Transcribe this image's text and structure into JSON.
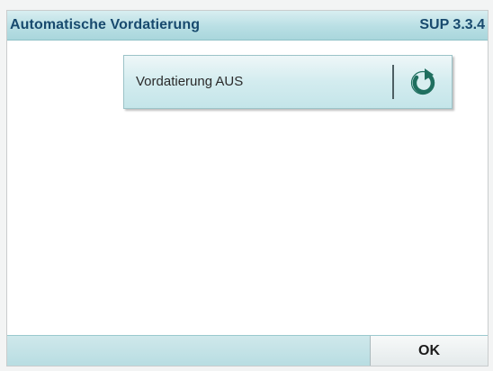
{
  "header": {
    "title": "Automatische Vordatierung",
    "version": "SUP 3.3.4"
  },
  "main": {
    "option": {
      "label": "Vordatierung AUS",
      "icon": "cycle-arrow-icon"
    }
  },
  "footer": {
    "ok_label": "OK"
  },
  "colors": {
    "title_text": "#184a6e",
    "titlebar": "#b9dfe4",
    "button_fill": "#d3ecef",
    "icon_fill": "#1f6f5f"
  }
}
